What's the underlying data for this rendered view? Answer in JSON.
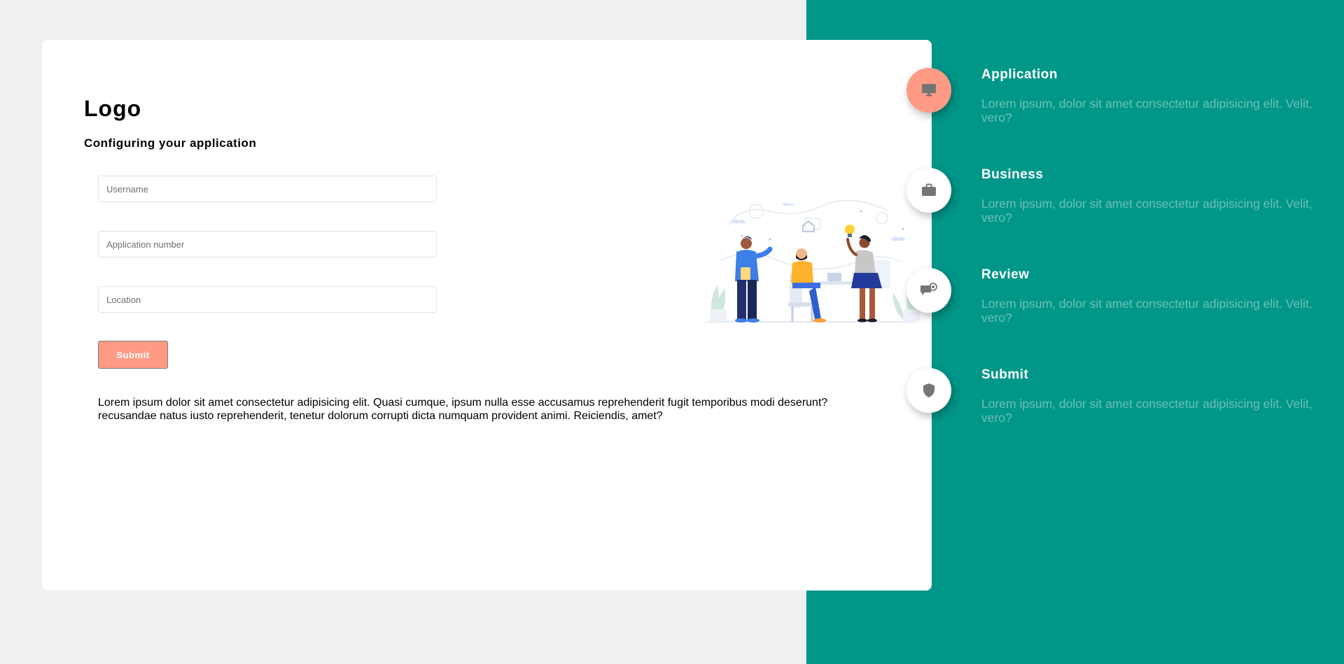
{
  "colors": {
    "teal": "#009688",
    "salmon": "#ff9b85",
    "background": "#f0f0f0",
    "card": "#ffffff",
    "step_desc": "#6cc1b6",
    "icon_gray": "#757575"
  },
  "form": {
    "logo": "Logo",
    "subtitle": "Configuring your application",
    "username_placeholder": "Username",
    "application_number_placeholder": "Application number",
    "location_placeholder": "Location",
    "submit_label": "Submit",
    "description": "Lorem ipsum dolor sit amet consectetur adipisicing elit. Quasi cumque, ipsum nulla esse accusamus reprehenderit fugit temporibus modi deserunt? recusandae natus iusto reprehenderit, tenetur dolorum corrupti dicta numquam provident animi. Reiciendis, amet?"
  },
  "steps": [
    {
      "title": "Application",
      "description": "Lorem ipsum, dolor sit amet consectetur adipisicing elit. Velit, vero?",
      "icon": "monitor-icon",
      "active": true
    },
    {
      "title": "Business",
      "description": "Lorem ipsum, dolor sit amet consectetur adipisicing elit. Velit, vero?",
      "icon": "briefcase-icon",
      "active": false
    },
    {
      "title": "Review",
      "description": "Lorem ipsum, dolor sit amet consectetur adipisicing elit. Velit, vero?",
      "icon": "review-chat-icon",
      "active": false
    },
    {
      "title": "Submit",
      "description": "Lorem ipsum, dolor sit amet consectetur adipisicing elit. Velit, vero?",
      "icon": "shield-icon",
      "active": false
    }
  ]
}
